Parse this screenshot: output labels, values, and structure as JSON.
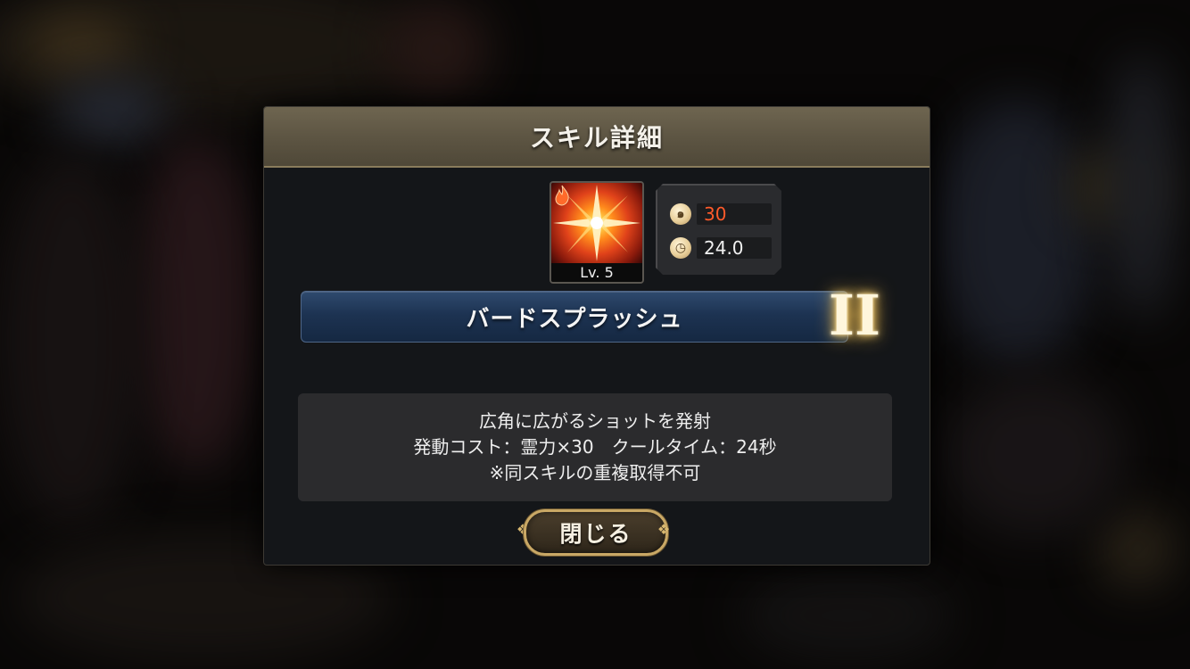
{
  "dialog": {
    "title": "スキル詳細"
  },
  "skill": {
    "level_label": "Lv. 5",
    "element_icon": "fire-element-icon",
    "name": "バードスプラッシュ",
    "rank": "II"
  },
  "stats": {
    "cost_icon": "spirit-cost-icon",
    "cost_value": "30",
    "time_icon": "cooldown-clock-icon",
    "time_value": "24.0"
  },
  "description": {
    "line1": "広角に広がるショットを発射",
    "line2": "発動コスト：霊力×30　クールタイム：24秒",
    "line3": "※同スキルの重複取得不可"
  },
  "buttons": {
    "close_label": "閉じる"
  },
  "colors": {
    "title_bar": "#5c5442",
    "name_bar": "#1d3352",
    "cost_text": "#ff5a2a",
    "close_border": "#c9a865"
  }
}
